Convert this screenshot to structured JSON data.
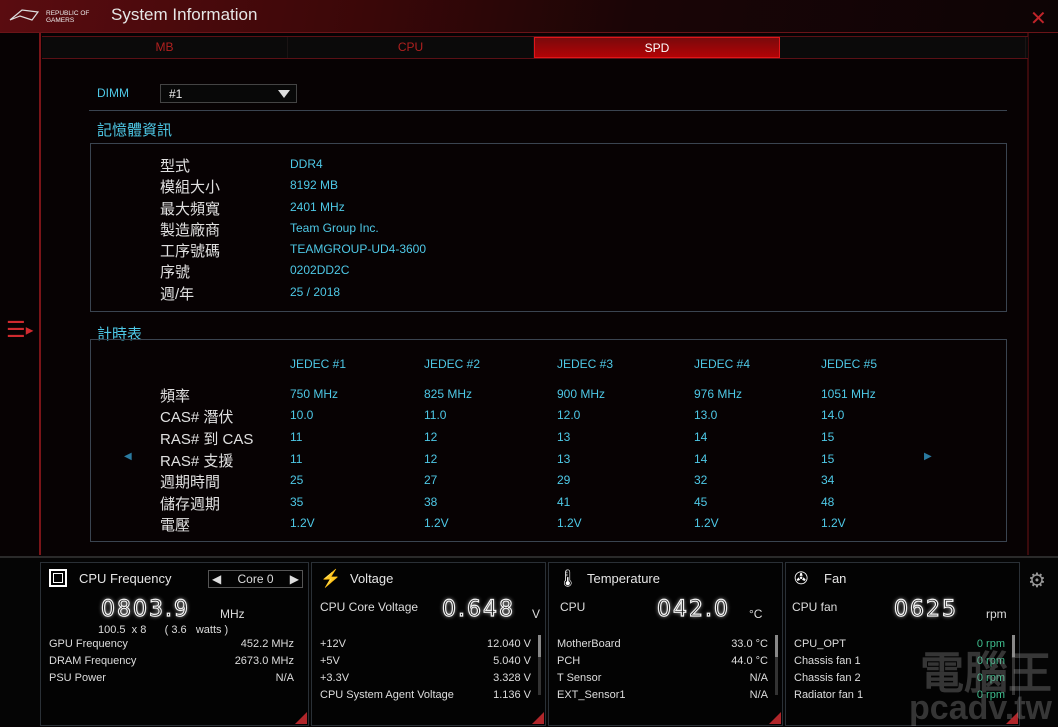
{
  "app": {
    "logo_text": "REPUBLIC OF GAMERS",
    "title": "System Information",
    "close_icon": "close-icon",
    "menu_icon": "hamburger-menu-icon"
  },
  "tabs": [
    {
      "label": "MB"
    },
    {
      "label": "CPU"
    },
    {
      "label": "SPD",
      "active": true
    },
    {
      "label": ""
    }
  ],
  "dimm": {
    "label": "DIMM",
    "selected": "#1"
  },
  "memory": {
    "title": "記憶體資訊",
    "rows": [
      {
        "label": "型式",
        "value": "DDR4"
      },
      {
        "label": "模組大小",
        "value": "8192 MB"
      },
      {
        "label": "最大頻寬",
        "value": "2401 MHz"
      },
      {
        "label": "製造廠商",
        "value": "Team Group Inc."
      },
      {
        "label": "工序號碼",
        "value": "TEAMGROUP-UD4-3600"
      },
      {
        "label": "序號",
        "value": "0202DD2C"
      },
      {
        "label": "週/年",
        "value": "25 / 2018"
      }
    ]
  },
  "timing": {
    "title": "計時表",
    "columns": [
      "JEDEC #1",
      "JEDEC #2",
      "JEDEC #3",
      "JEDEC #4",
      "JEDEC #5"
    ],
    "rows": [
      {
        "label": "頻率",
        "values": [
          "750 MHz",
          "825 MHz",
          "900 MHz",
          "976 MHz",
          "1051 MHz"
        ]
      },
      {
        "label": "CAS# 潛伏",
        "values": [
          "10.0",
          "11.0",
          "12.0",
          "13.0",
          "14.0"
        ]
      },
      {
        "label": "RAS# 到 CAS",
        "values": [
          "11",
          "12",
          "13",
          "14",
          "15"
        ]
      },
      {
        "label": "RAS# 支援",
        "values": [
          "11",
          "12",
          "13",
          "14",
          "15"
        ]
      },
      {
        "label": "週期時間",
        "values": [
          "25",
          "27",
          "29",
          "32",
          "34"
        ]
      },
      {
        "label": "儲存週期",
        "values": [
          "35",
          "38",
          "41",
          "45",
          "48"
        ]
      },
      {
        "label": "電壓",
        "values": [
          "1.2V",
          "1.2V",
          "1.2V",
          "1.2V",
          "1.2V"
        ]
      }
    ],
    "prev": "◀",
    "next": "▶"
  },
  "cpu_freq": {
    "title": "CPU Frequency",
    "core": "Core 0",
    "value": "0803.9",
    "unit": "MHz",
    "sub": "100.5  x 8      ( 3.6   watts )",
    "rows": [
      {
        "label": "GPU Frequency",
        "value": "452.2  MHz"
      },
      {
        "label": "DRAM Frequency",
        "value": "2673.0  MHz"
      },
      {
        "label": "PSU Power",
        "value": "N/A"
      }
    ]
  },
  "voltage": {
    "title": "Voltage",
    "main_label": "CPU Core Voltage",
    "value": "0.648",
    "unit": "V",
    "rows": [
      {
        "label": "+12V",
        "value": "12.040  V"
      },
      {
        "label": "+5V",
        "value": "5.040  V"
      },
      {
        "label": "+3.3V",
        "value": "3.328  V"
      },
      {
        "label": "CPU System Agent Voltage",
        "value": "1.136  V"
      }
    ]
  },
  "temperature": {
    "title": "Temperature",
    "main_label": "CPU",
    "value": "042.0",
    "unit": "°C",
    "rows": [
      {
        "label": "MotherBoard",
        "value": "33.0 °C"
      },
      {
        "label": "PCH",
        "value": "44.0 °C"
      },
      {
        "label": "T Sensor",
        "value": "N/A"
      },
      {
        "label": "EXT_Sensor1",
        "value": "N/A"
      }
    ]
  },
  "fan": {
    "title": "Fan",
    "main_label": "CPU fan",
    "value": "0625",
    "unit": "rpm",
    "rows": [
      {
        "label": "CPU_OPT",
        "value": "0  rpm"
      },
      {
        "label": "Chassis fan 1",
        "value": "0  rpm"
      },
      {
        "label": "Chassis fan 2",
        "value": "0  rpm"
      },
      {
        "label": "Radiator fan 1",
        "value": "0  rpm"
      }
    ]
  },
  "watermark": {
    "line1": "電腦王",
    "line2": "pcadv.tw"
  },
  "colors": {
    "accent": "#c0242a",
    "info": "#4ec8e6",
    "fan_value": "#3fbf8f"
  }
}
